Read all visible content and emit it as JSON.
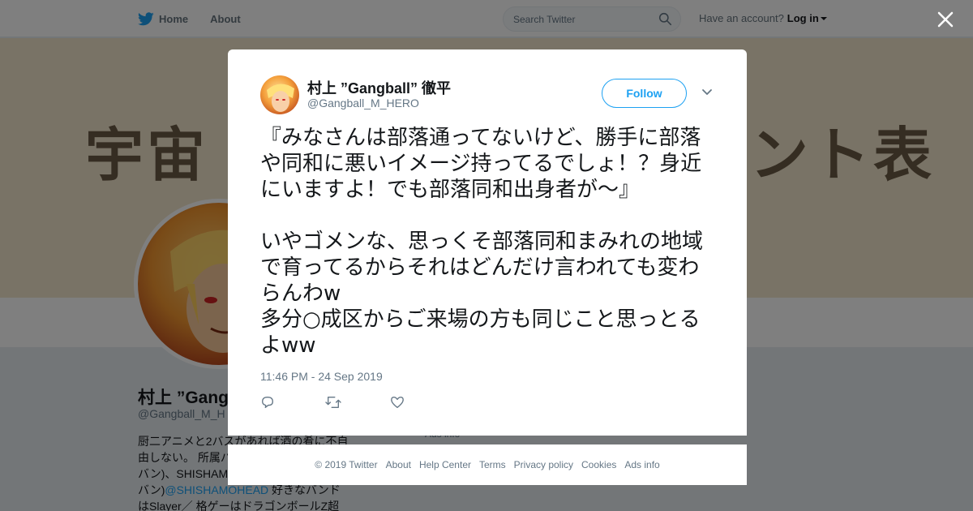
{
  "nav": {
    "home_label": "Home",
    "about_label": "About",
    "search_placeholder": "Search Twitter",
    "account_prompt": "Have an account?",
    "login_label": "Log in"
  },
  "banner": {
    "left_text": "宇宙",
    "right_text": "ント表"
  },
  "profile": {
    "name": "村上 ”Gang",
    "handle": "@Gangball_M_H",
    "bio_lines": [
      "厨二アニメと2バスがあれば酒の肴に不自",
      "由しない。 所属バ",
      "バン)、SHISHAM",
      "バン)"
    ],
    "bio_mention": "@SHISHAMOHEAD",
    "bio_after_mention": " 好きなバンド",
    "bio_last_line": "はSlayer／ 格ゲーはドラゴンボールZ超",
    "ads_info": "Ads info"
  },
  "tweet": {
    "name": "村上 ”Gangball” 徹平",
    "handle": "@Gangball_M_HERO",
    "follow_label": "Follow",
    "text": "『みなさんは部落通ってないけど、勝手に部落や同和に悪いイメージ持ってるでしょ！？身近にいますよ！でも部落同和出身者が～』\n\nいやゴメンな、思っくそ部落同和まみれの地域で育ってるからそれはどんだけ言われても変わらんわw\n多分○成区からご来場の方も同じこと思っとるよww",
    "timestamp": "11:46 PM - 24 Sep 2019"
  },
  "footer": {
    "links": [
      "© 2019 Twitter",
      "About",
      "Help Center",
      "Terms",
      "Privacy policy",
      "Cookies",
      "Ads info"
    ]
  },
  "colors": {
    "brand": "#1da1f2",
    "text_primary": "#14171a",
    "text_secondary": "#657786"
  },
  "icons": {
    "logo": "twitter-bird-icon",
    "search": "search-icon",
    "close": "close-icon",
    "more": "chevron-down-icon",
    "reply": "reply-icon",
    "retweet": "retweet-icon",
    "like": "heart-icon"
  }
}
